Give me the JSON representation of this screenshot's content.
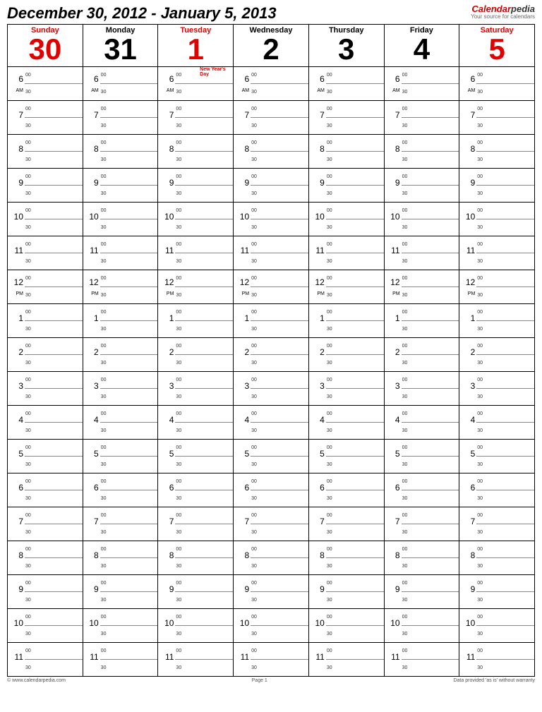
{
  "title": "December 30, 2012 - January 5, 2013",
  "brand": {
    "name1": "Calendar",
    "name2": "pedia",
    "tagline": "Your source for calendars"
  },
  "days": [
    {
      "name": "Sunday",
      "num": "30",
      "cls": "weekend",
      "event": ""
    },
    {
      "name": "Monday",
      "num": "31",
      "cls": "",
      "event": ""
    },
    {
      "name": "Tuesday",
      "num": "1",
      "cls": "holiday",
      "event": "New Year's Day"
    },
    {
      "name": "Wednesday",
      "num": "2",
      "cls": "",
      "event": ""
    },
    {
      "name": "Thursday",
      "num": "3",
      "cls": "",
      "event": ""
    },
    {
      "name": "Friday",
      "num": "4",
      "cls": "",
      "event": ""
    },
    {
      "name": "Saturday",
      "num": "5",
      "cls": "weekend",
      "event": ""
    }
  ],
  "hours": [
    {
      "h": "6",
      "ampm": "AM"
    },
    {
      "h": "7",
      "ampm": ""
    },
    {
      "h": "8",
      "ampm": ""
    },
    {
      "h": "9",
      "ampm": ""
    },
    {
      "h": "10",
      "ampm": ""
    },
    {
      "h": "11",
      "ampm": ""
    },
    {
      "h": "12",
      "ampm": "PM"
    },
    {
      "h": "1",
      "ampm": ""
    },
    {
      "h": "2",
      "ampm": ""
    },
    {
      "h": "3",
      "ampm": ""
    },
    {
      "h": "4",
      "ampm": ""
    },
    {
      "h": "5",
      "ampm": ""
    },
    {
      "h": "6",
      "ampm": ""
    },
    {
      "h": "7",
      "ampm": ""
    },
    {
      "h": "8",
      "ampm": ""
    },
    {
      "h": "9",
      "ampm": ""
    },
    {
      "h": "10",
      "ampm": ""
    },
    {
      "h": "11",
      "ampm": ""
    }
  ],
  "minute_labels": {
    "top": "00",
    "bottom": "30"
  },
  "footer": {
    "left": "© www.calendarpedia.com",
    "mid": "Page 1",
    "right": "Data provided 'as is' without warranty"
  }
}
